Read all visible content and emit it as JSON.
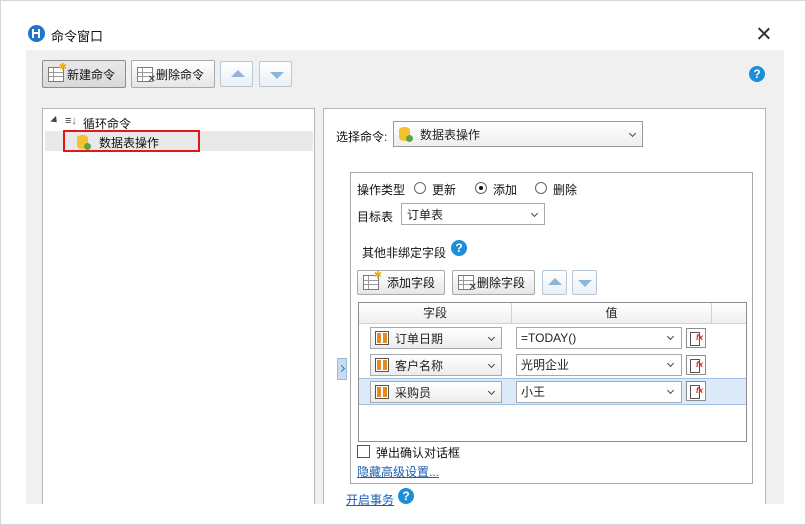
{
  "window": {
    "title": "命令窗口"
  },
  "toolbar": {
    "new_command_label": "新建命令",
    "delete_command_label": "删除命令",
    "help_glyph": "?"
  },
  "tree": {
    "root_label": "循环命令",
    "child_label": "数据表操作"
  },
  "command_selector": {
    "label": "选择命令:",
    "selected": "数据表操作"
  },
  "operation": {
    "type_label": "操作类型",
    "options": [
      "更新",
      "添加",
      "删除"
    ],
    "selected": "添加"
  },
  "target_table": {
    "label": "目标表",
    "selected": "订单表"
  },
  "unbound_fields": {
    "label": "其他非绑定字段",
    "help_glyph": "?",
    "add_field_label": "添加字段",
    "delete_field_label": "删除字段"
  },
  "field_grid": {
    "columns": [
      "字段",
      "值"
    ],
    "rows": [
      {
        "field": "订单日期",
        "value": "=TODAY()"
      },
      {
        "field": "客户名称",
        "value": "光明企业"
      },
      {
        "field": "采购员",
        "value": "小王"
      }
    ],
    "selected_row": 2
  },
  "confirm_dialog": {
    "label": "弹出确认对话框",
    "checked": false
  },
  "advanced_link": "隐藏高级设置...",
  "transaction": {
    "link": "开启事务",
    "help_glyph": "?"
  },
  "colors": {
    "accent": "#1c8fd8",
    "highlight_border": "#e01818",
    "link": "#1a5fb4",
    "row_selected": "#dbe9f8"
  }
}
